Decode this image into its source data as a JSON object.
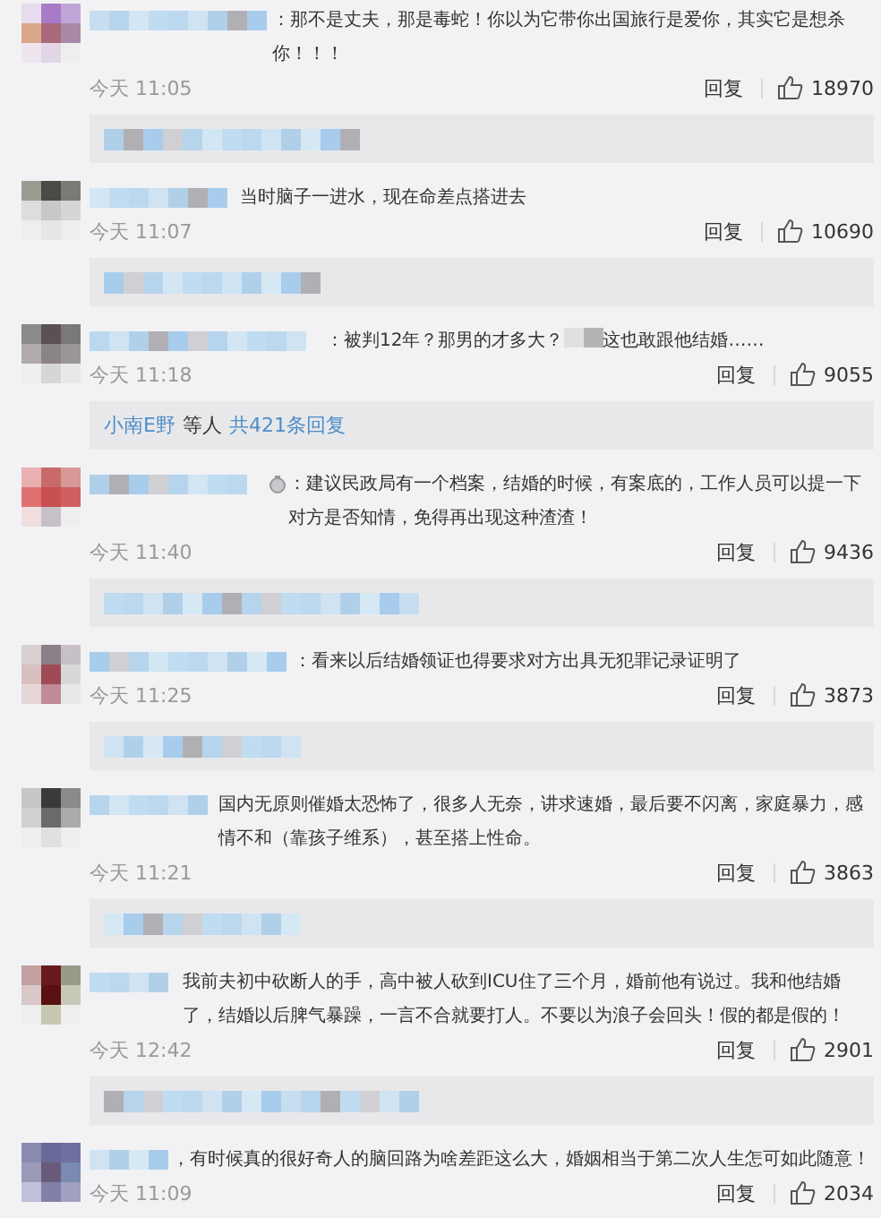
{
  "comments": [
    {
      "parts": [
        "：那不是丈夫，那是毒蛇！你以为它带你出国旅行是爱你，其实它是想杀你！！！"
      ],
      "time": "今天 11:05",
      "reply": "回复",
      "likes": "18970",
      "thread": {
        "kind": "blurred"
      }
    },
    {
      "parts": [
        "当时脑子一进水，现在命差点搭进去"
      ],
      "time": "今天 11:07",
      "reply": "回复",
      "likes": "10690",
      "thread": {
        "kind": "blurred"
      }
    },
    {
      "parts": [
        "：被判12年？那男的才多大？",
        "这也敢跟他结婚……"
      ],
      "time": "今天 11:18",
      "reply": "回复",
      "likes": "9055",
      "thread": {
        "kind": "replies",
        "user": "小南E野",
        "middle": "等人",
        "count": "共421条回复"
      }
    },
    {
      "parts": [
        "：建议民政局有一个档案，结婚的时候，有案底的，工作人员可以提一下对方是否知情，免得再出现这种渣渣！"
      ],
      "badge": true,
      "time": "今天 11:40",
      "reply": "回复",
      "likes": "9436",
      "thread": {
        "kind": "blurred"
      }
    },
    {
      "parts": [
        "：看来以后结婚领证也得要求对方出具无犯罪记录证明了"
      ],
      "time": "今天 11:25",
      "reply": "回复",
      "likes": "3873",
      "thread": {
        "kind": "blurred"
      }
    },
    {
      "parts": [
        "国内无原则催婚太恐怖了，很多人无奈，讲求速婚，最后要不闪离，家庭暴力，感情不和（靠孩子维系），甚至搭上性命。"
      ],
      "time": "今天 11:21",
      "reply": "回复",
      "likes": "3863",
      "thread": {
        "kind": "blurred"
      }
    },
    {
      "parts": [
        "我前夫初中砍断人的手，高中被人砍到ICU住了三个月，婚前他有说过。我和他结婚了，结婚以后脾气暴躁，一言不合就要打人。不要以为浪子会回头！假的都是假的！"
      ],
      "time": "今天 12:42",
      "reply": "回复",
      "likes": "2901",
      "thread": {
        "kind": "blurred"
      }
    },
    {
      "parts": [
        "，有时候真的很好奇人的脑回路为啥差距这么大，婚姻相当于第二次人生怎可如此随意！"
      ],
      "time": "今天 11:09",
      "reply": "回复",
      "likes": "2034"
    }
  ]
}
